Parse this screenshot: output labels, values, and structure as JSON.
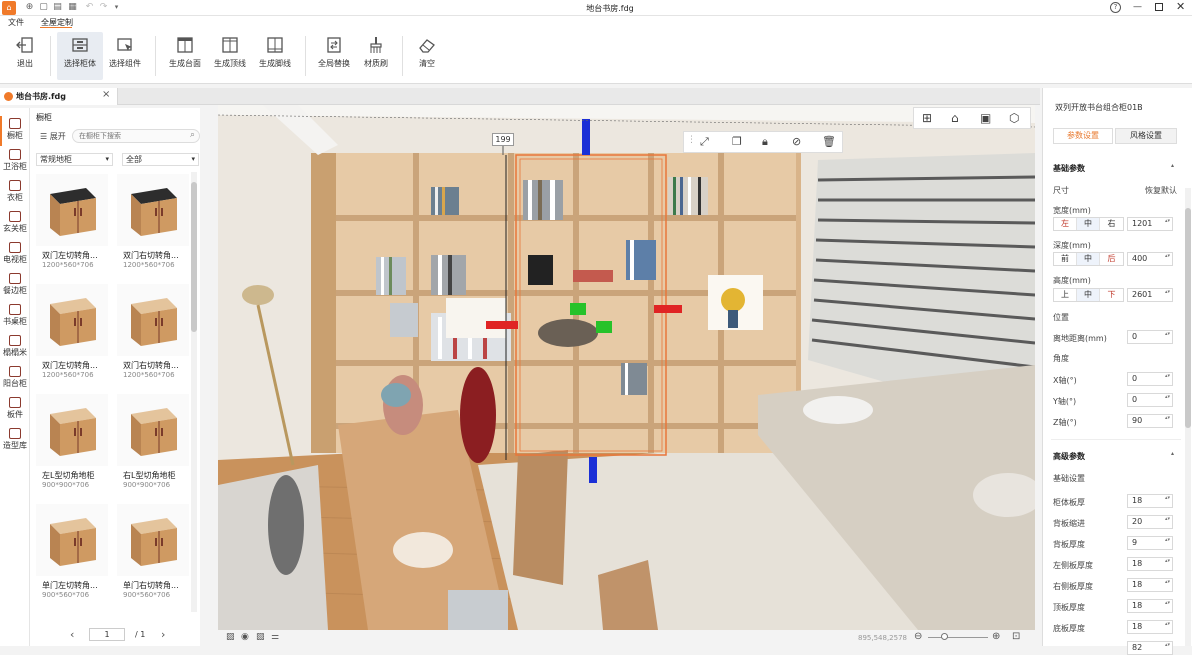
{
  "window": {
    "title": "地台书房.fdg"
  },
  "menu": {
    "file": "文件",
    "whole_house": "全屋定制"
  },
  "ribbon": [
    {
      "key": "exit",
      "label": "退出"
    },
    {
      "key": "select_cabinet",
      "label": "选择柜体"
    },
    {
      "key": "select_component",
      "label": "选择组件"
    },
    {
      "key": "gen_countertop",
      "label": "生成台面"
    },
    {
      "key": "gen_top_line",
      "label": "生成顶线"
    },
    {
      "key": "gen_skirting",
      "label": "生成脚线"
    },
    {
      "key": "global_replace",
      "label": "全局替换"
    },
    {
      "key": "material_brush",
      "label": "材质刷"
    },
    {
      "key": "clear",
      "label": "清空"
    }
  ],
  "doc_tab": {
    "label": "地台书房.fdg",
    "close": "×"
  },
  "categories": [
    "橱柜",
    "卫浴柜",
    "衣柜",
    "玄关柜",
    "电视柜",
    "餐边柜",
    "书桌柜",
    "榻榻米",
    "阳台柜",
    "板件",
    "造型库"
  ],
  "panel": {
    "title": "橱柜",
    "expand": "展开",
    "search_placeholder": "在橱柜下搜索",
    "filter1": "常规地柜",
    "filter2": "全部",
    "items": [
      {
        "name": "双门左切转角...",
        "size": "1200*560*706"
      },
      {
        "name": "双门右切转角...",
        "size": "1200*560*706"
      },
      {
        "name": "双门左切转角...",
        "size": "1200*560*706"
      },
      {
        "name": "双门右切转角...",
        "size": "1200*560*706"
      },
      {
        "name": "左L型切角地柜",
        "size": "900*900*706"
      },
      {
        "name": "右L型切角地柜",
        "size": "900*900*706"
      },
      {
        "name": "单门左切转角...",
        "size": "900*560*706"
      },
      {
        "name": "单门右切转角...",
        "size": "900*560*706"
      }
    ],
    "pager": {
      "page": "1",
      "total": "/ 1",
      "prev": "‹",
      "next": "›"
    }
  },
  "viewport": {
    "dimension_label": "199",
    "status_coords": "895,548,2578"
  },
  "props": {
    "product_name": "双列开放书台组合柜01B",
    "tabs": [
      "参数设置",
      "风格设置"
    ],
    "basic_section": "基础参数",
    "size_label": "尺寸",
    "restore_default": "恢复默认",
    "width": {
      "label": "宽度(mm)",
      "opts": [
        "左",
        "中",
        "右"
      ],
      "value": "1201"
    },
    "depth": {
      "label": "深度(mm)",
      "opts": [
        "前",
        "中",
        "后"
      ],
      "value": "400"
    },
    "height": {
      "label": "高度(mm)",
      "opts": [
        "上",
        "中",
        "下"
      ],
      "value": "2601"
    },
    "position_label": "位置",
    "ground_dist": {
      "label": "离地距离(mm)",
      "value": "0"
    },
    "angle_label": "角度",
    "x_axis": {
      "label": "X轴(°)",
      "value": "0"
    },
    "y_axis": {
      "label": "Y轴(°)",
      "value": "0"
    },
    "z_axis": {
      "label": "Z轴(°)",
      "value": "90"
    },
    "advanced_section": "高级参数",
    "basic_settings": "基础设置",
    "adv": [
      {
        "label": "柜体板厚",
        "value": "18"
      },
      {
        "label": "背板缩进",
        "value": "20"
      },
      {
        "label": "背板厚度",
        "value": "9"
      },
      {
        "label": "左侧板厚度",
        "value": "18"
      },
      {
        "label": "右侧板厚度",
        "value": "18"
      },
      {
        "label": "顶板厚度",
        "value": "18"
      },
      {
        "label": "底板厚度",
        "value": "18"
      },
      {
        "label": "",
        "value": "82"
      }
    ]
  },
  "colors": {
    "accent": "#e8792e",
    "brand": "#f07a2a",
    "selection": "#e8763a",
    "gizmo_blue": "#1b2fd6",
    "gizmo_red": "#e02424",
    "gizmo_green": "#27c22a"
  }
}
